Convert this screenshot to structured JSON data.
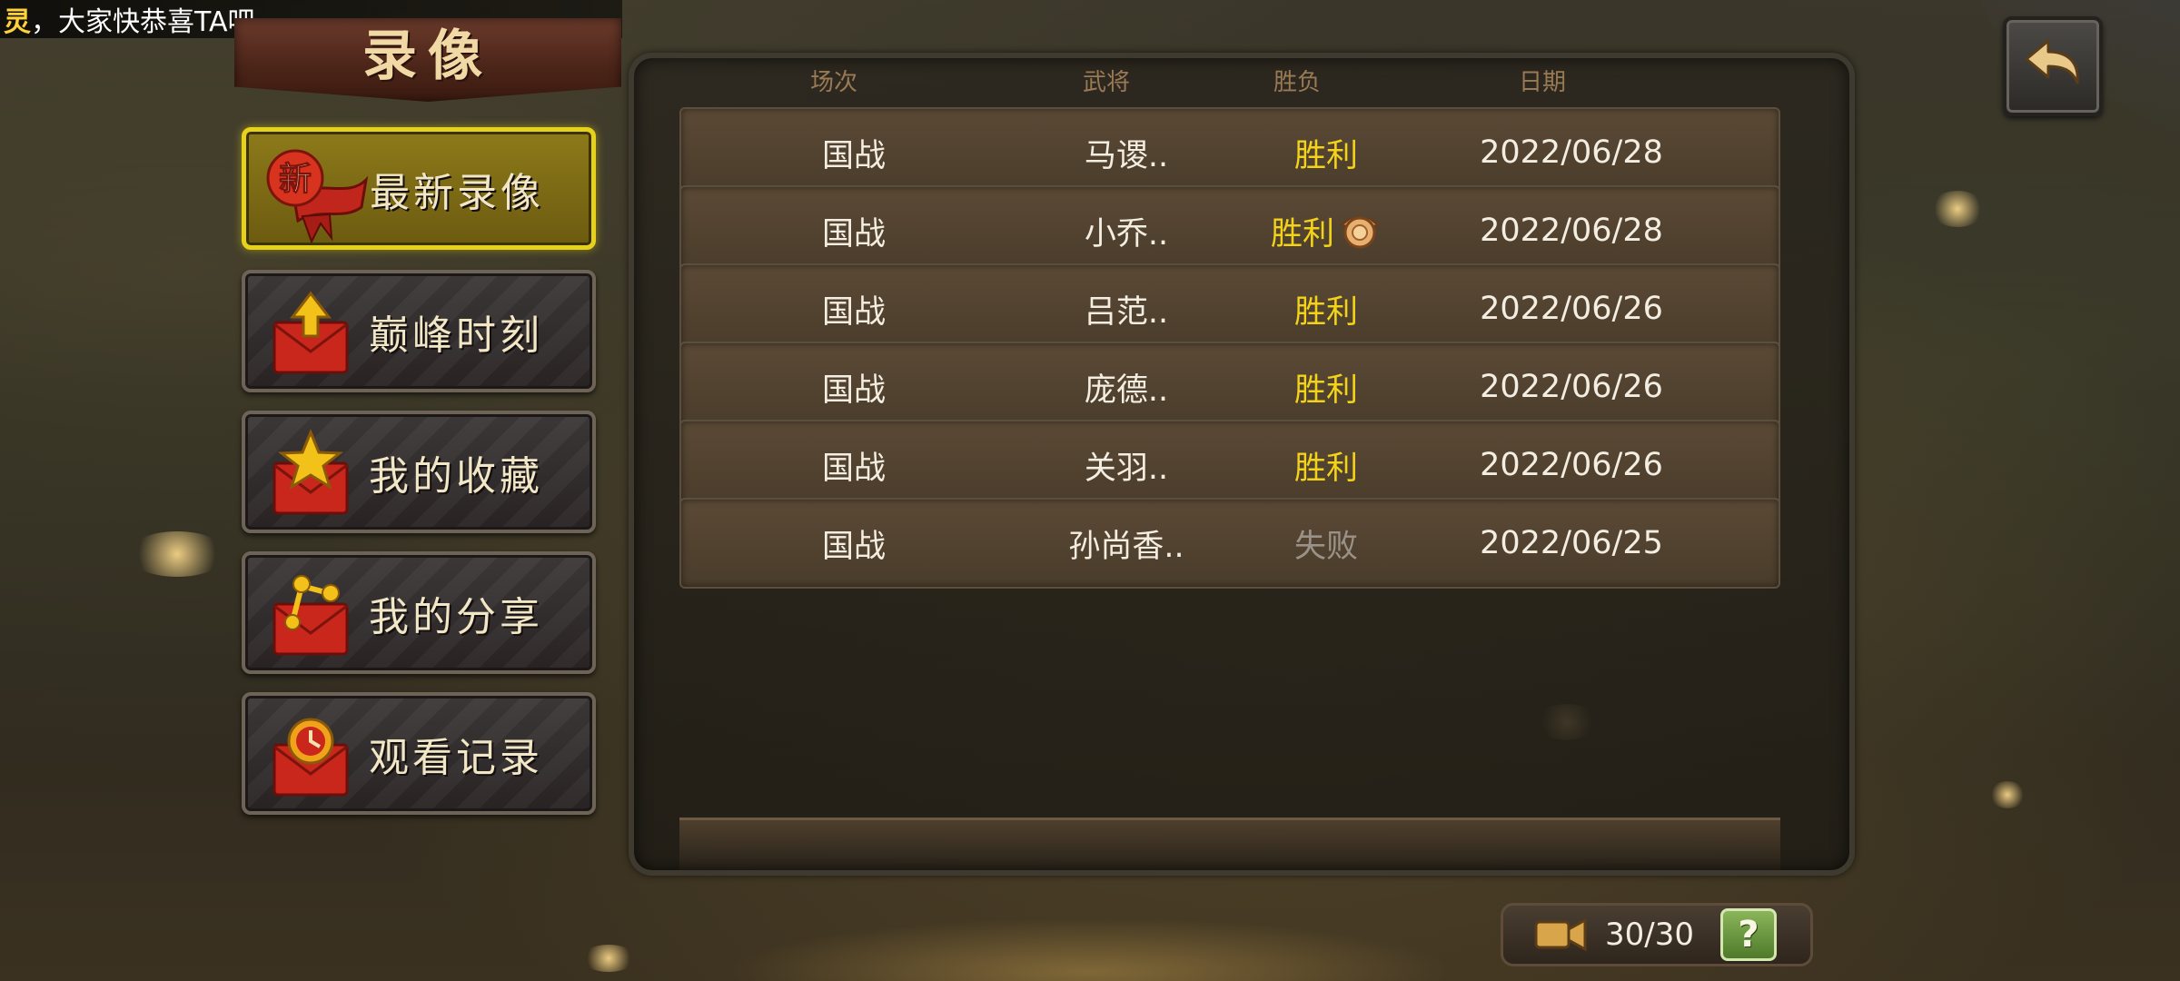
{
  "marquee": {
    "highlight": "灵",
    "message": "，大家快恭喜TA吧"
  },
  "page_title": "录像",
  "menu": [
    {
      "label": "最新录像",
      "icon": "new-ribbon-icon",
      "active": true
    },
    {
      "label": "巅峰时刻",
      "icon": "envelope-arrow-up-icon",
      "active": false
    },
    {
      "label": "我的收藏",
      "icon": "envelope-star-icon",
      "active": false
    },
    {
      "label": "我的分享",
      "icon": "envelope-share-icon",
      "active": false
    },
    {
      "label": "观看记录",
      "icon": "envelope-clock-icon",
      "active": false
    }
  ],
  "new_badge_text": "新",
  "table": {
    "headers": [
      "场次",
      "武将",
      "胜负",
      "日期"
    ],
    "rows": [
      {
        "mode": "国战",
        "general": "马谡..",
        "result": "胜利",
        "win": true,
        "medal": false,
        "date": "2022/06/28"
      },
      {
        "mode": "国战",
        "general": "小乔..",
        "result": "胜利",
        "win": true,
        "medal": true,
        "date": "2022/06/28"
      },
      {
        "mode": "国战",
        "general": "吕范..",
        "result": "胜利",
        "win": true,
        "medal": false,
        "date": "2022/06/26"
      },
      {
        "mode": "国战",
        "general": "庞德..",
        "result": "胜利",
        "win": true,
        "medal": false,
        "date": "2022/06/26"
      },
      {
        "mode": "国战",
        "general": "关羽..",
        "result": "胜利",
        "win": true,
        "medal": false,
        "date": "2022/06/26"
      },
      {
        "mode": "国战",
        "general": "孙尚香..",
        "result": "失败",
        "win": false,
        "medal": false,
        "date": "2022/06/25"
      }
    ]
  },
  "footer": {
    "count": "30/30",
    "help_label": "?"
  },
  "colors": {
    "win": "#f3d21a",
    "lose": "#9a9288",
    "active_border": "#e6d21a"
  }
}
